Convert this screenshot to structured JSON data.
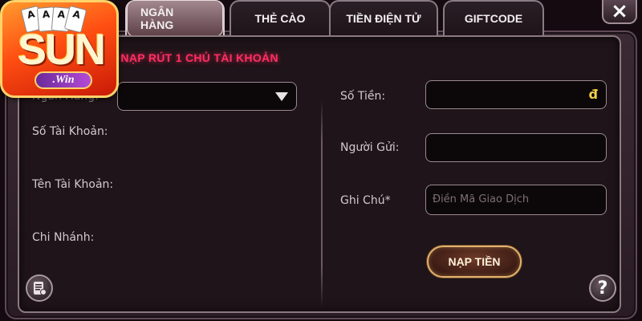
{
  "tabs": [
    {
      "label": "NGÂN HÀNG",
      "active": true
    },
    {
      "label": "THẺ CÀO",
      "active": false
    },
    {
      "label": "TIỀN ĐIỆN TỬ",
      "active": false
    },
    {
      "label": "GIFTCODE",
      "active": false
    }
  ],
  "close_icon": "×",
  "heading": "Ợ NẠP RÚT 1 CHỦ TÀI KHOẢN",
  "left_form": {
    "bank_label": "Ngân Hàng:",
    "account_number_label": "Số Tài Khoản:",
    "account_name_label": "Tên Tài Khoản:",
    "branch_label": "Chi Nhánh:"
  },
  "right_form": {
    "amount_label": "Số Tiền:",
    "amount_currency": "đ",
    "sender_label": "Người Gửi:",
    "note_label": "Ghi Chú*",
    "note_placeholder": "Điền Mã Giao Dịch"
  },
  "submit_label": "NẠP TIỀN",
  "help_icon": "?",
  "logo": {
    "name": "SUN",
    "sub": ".Win",
    "cards": [
      "A",
      "A",
      "A",
      "A"
    ]
  },
  "colors": {
    "heading": "#ff2e63",
    "currency": "#f2d24a",
    "button_border": "#e2b36e",
    "logo_orange": "#ff4e12"
  }
}
